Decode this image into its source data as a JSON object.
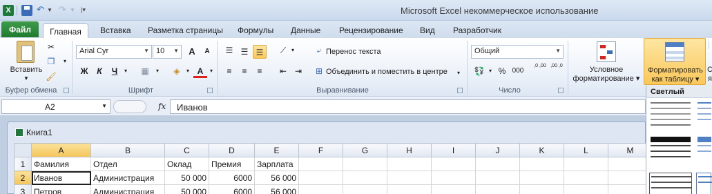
{
  "window": {
    "title": "Microsoft Excel некоммерческое использование",
    "app_icon_letter": "X",
    "qat": {
      "undo": "↶",
      "redo": "↷"
    }
  },
  "tabs": [
    "Файл",
    "Главная",
    "Вставка",
    "Разметка страницы",
    "Формулы",
    "Данные",
    "Рецензирование",
    "Вид",
    "Разработчик"
  ],
  "ribbon": {
    "clipboard": {
      "paste": "Вставить",
      "label": "Буфер обмена"
    },
    "font": {
      "name": "Arial Cyr",
      "size": "10",
      "grow": "A",
      "shrink": "A",
      "bold": "Ж",
      "italic": "К",
      "underline": "Ч",
      "color_letter": "A",
      "label": "Шрифт"
    },
    "alignment": {
      "wrap": "Перенос текста",
      "merge": "Объединить и поместить в центре",
      "label": "Выравнивание"
    },
    "number": {
      "format": "Общий",
      "percent": "%",
      "thousands": "000",
      "inc": ",0 ,00",
      "dec": ",00 ,0",
      "label": "Число"
    },
    "styles": {
      "conditional_line1": "Условное",
      "conditional_line2": "форматирование",
      "format_table_line1": "Форматировать",
      "format_table_line2": "как таблицу",
      "cut_c": "С",
      "cut_ya": "я"
    }
  },
  "formula_bar": {
    "name_box": "A2",
    "fx": "fx",
    "content": "Иванов"
  },
  "workbook": {
    "title": "Книга1"
  },
  "grid": {
    "columns": [
      "A",
      "B",
      "C",
      "D",
      "E",
      "F",
      "G",
      "H",
      "I",
      "J",
      "K",
      "L",
      "M"
    ],
    "rows": [
      {
        "num": "1",
        "cells": [
          "Фамилия",
          "Отдел",
          "Оклад",
          "Премия",
          "Зарплата",
          "",
          "",
          "",
          "",
          "",
          "",
          "",
          ""
        ]
      },
      {
        "num": "2",
        "cells": [
          "Иванов",
          "Администрация",
          "50 000",
          "6000",
          "56 000",
          "",
          "",
          "",
          "",
          "",
          "",
          "",
          ""
        ]
      },
      {
        "num": "3",
        "cells": [
          "Петров",
          "Администрация",
          "50 000",
          "6000",
          "56 000",
          "",
          "",
          "",
          "",
          "",
          "",
          "",
          ""
        ]
      }
    ]
  },
  "gallery": {
    "section": "Светлый"
  },
  "colors": {
    "file_tab": "#2a8a3a",
    "selection": "#f6d36f",
    "accent": "#2e6ab3"
  }
}
